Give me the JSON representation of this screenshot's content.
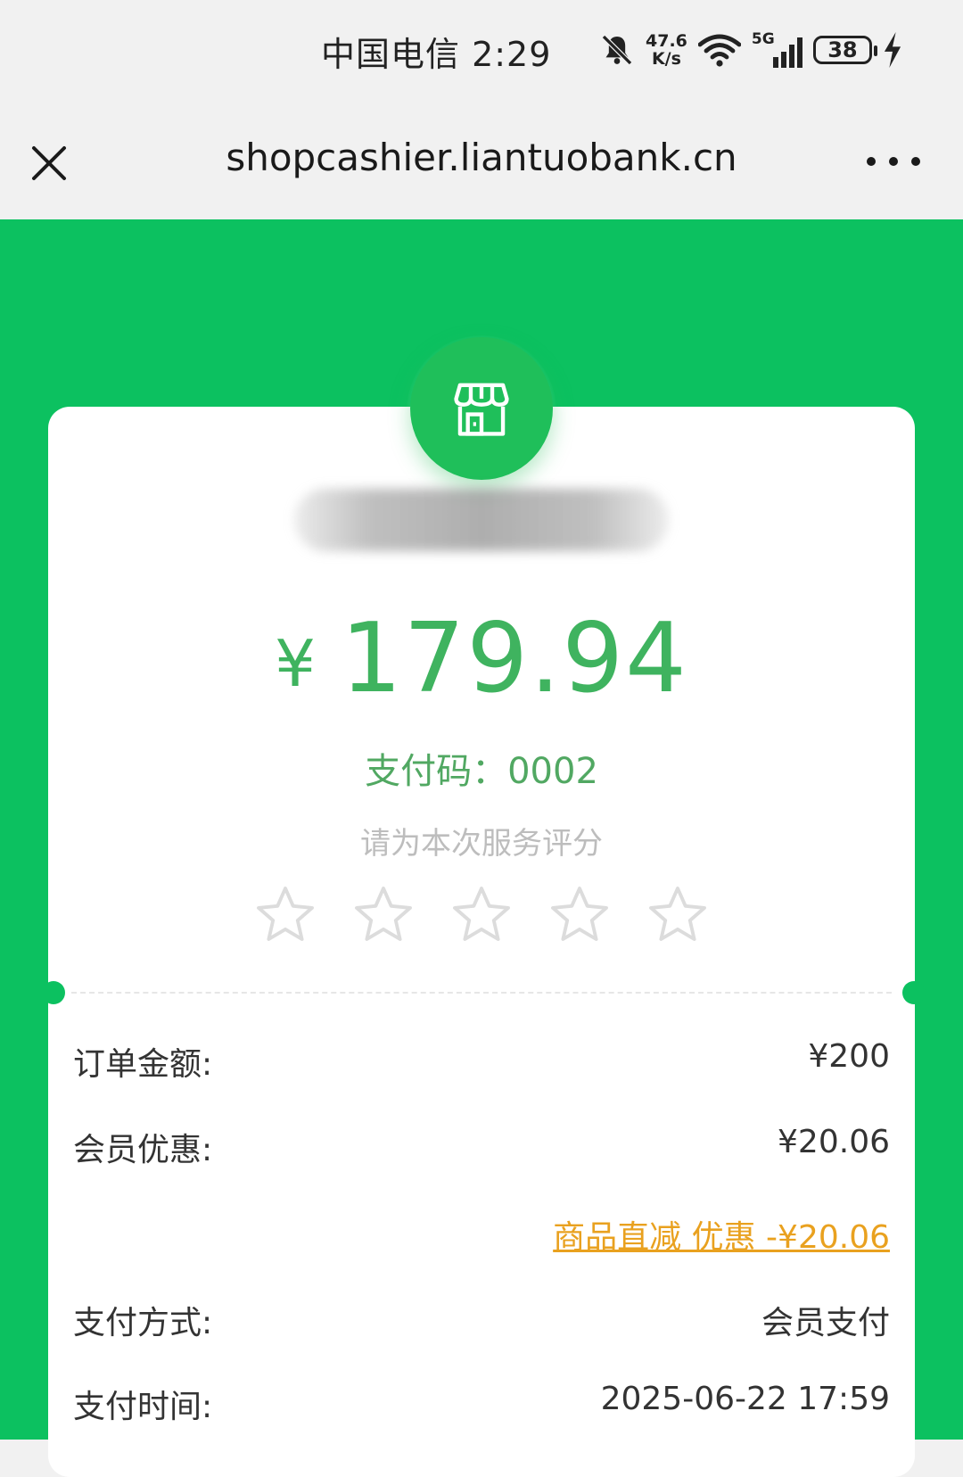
{
  "status_bar": {
    "carrier_time": "中国电信 2:29",
    "net_speed_value": "47.6",
    "net_speed_unit": "K/s",
    "network": "5G",
    "battery": "38",
    "icons": [
      "mute-bell-icon",
      "wifi-icon",
      "signal-icon",
      "battery-icon",
      "charging-icon"
    ]
  },
  "nav": {
    "url": "shopcashier.liantuobank.cn",
    "close_icon": "close-icon",
    "more_icon": "more-icon"
  },
  "receipt": {
    "currency_symbol": "¥",
    "amount": "179.94",
    "pay_code": "支付码：0002",
    "rating_prompt": "请为本次服务评分",
    "rating_stars_total": 5,
    "rating_selected": 0
  },
  "details": {
    "order_amount_label": "订单金额:",
    "order_amount_value": "¥200",
    "member_discount_label": "会员优惠:",
    "member_discount_value": "¥20.06",
    "discount_detail": "商品直减 优惠 -¥20.06",
    "pay_method_label": "支付方式:",
    "pay_method_value": "会员支付",
    "pay_time_label": "支付时间:",
    "pay_time_value": "2025-06-22 17:59"
  },
  "colors": {
    "brand_green": "#0cc160",
    "amount_green": "#3fb35f",
    "discount_orange": "#e9a11f"
  }
}
